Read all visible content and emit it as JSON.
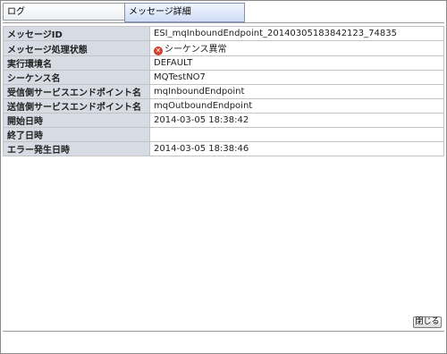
{
  "tabs": {
    "log": "ログ",
    "detail": "メッセージ詳細"
  },
  "detail_rows": [
    {
      "label": "メッセージID",
      "value": "ESI_mqInboundEndpoint_20140305183842123_74835"
    },
    {
      "label": "メッセージ処理状態",
      "value": "シーケンス異常",
      "icon": "error-icon"
    },
    {
      "label": "実行環境名",
      "value": "DEFAULT"
    },
    {
      "label": "シーケンス名",
      "value": "MQTestNO7"
    },
    {
      "label": "受信側サービスエンドポイント名",
      "value": "mqInboundEndpoint"
    },
    {
      "label": "送信側サービスエンドポイント名",
      "value": "mqOutboundEndpoint"
    },
    {
      "label": "開始日時",
      "value": "2014-03-05 18:38:42"
    },
    {
      "label": "終了日時",
      "value": ""
    },
    {
      "label": "エラー発生日時",
      "value": "2014-03-05 18:38:46"
    }
  ],
  "close_label": "閉じる",
  "colors": {
    "label_bg": "#d7dbe3",
    "active_tab_bg": "#cfdcf5",
    "error_icon": "#d43c2c"
  }
}
